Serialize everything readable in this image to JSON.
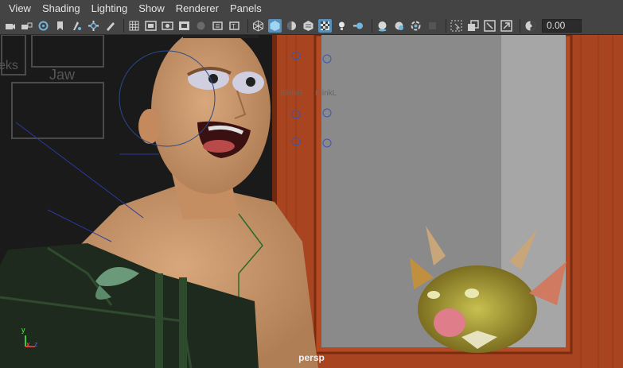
{
  "menu": [
    "View",
    "Shading",
    "Lighting",
    "Show",
    "Renderer",
    "Panels"
  ],
  "toolbar": {
    "icons": [
      "camera-select-icon",
      "camera-lock-icon",
      "camera-attributes-icon",
      "bookmark-icon",
      "image-plane-icon",
      "2d-pan-zoom-icon",
      "grease-pencil-icon",
      "grid-icon",
      "film-gate-icon",
      "resolution-gate-icon",
      "gate-mask-icon",
      "field-chart-icon",
      "safe-action-icon",
      "safe-title-icon",
      "wireframe-icon",
      "smooth-shade-icon",
      "default-lighting-icon",
      "textured-icon",
      "shadows-icon",
      "use-lights-icon",
      "screen-space-ao-icon",
      "motion-blur-icon",
      "multisample-aa-icon",
      "depth-of-field-icon",
      "isolate-select-icon",
      "xray-icon",
      "xray-active-icon",
      "xray-joints-icon",
      "backface-culling-icon",
      "exposure-icon"
    ],
    "exposure_value": "0.00"
  },
  "viewport": {
    "camera_label": "persp",
    "panel_labels": [
      "eks",
      "Jaw",
      "BlinkR",
      "BlinkL"
    ],
    "axis": {
      "x": "x",
      "y": "y",
      "z": "z"
    }
  }
}
